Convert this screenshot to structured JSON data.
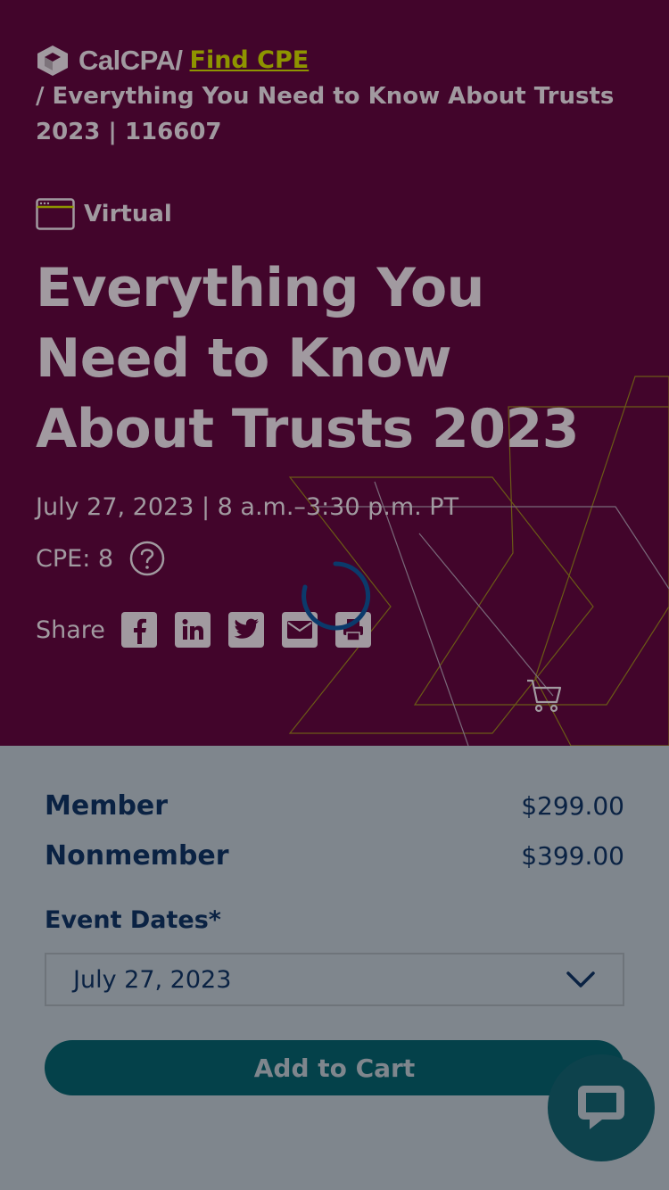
{
  "breadcrumb": {
    "logo_text": "CalCPA/",
    "link": "Find CPE",
    "rest": "/ Everything You Need to Know About Trusts 2023 | 116607"
  },
  "event": {
    "format": "Virtual",
    "title": "Everything You Need to Know About Trusts 2023",
    "date_time": "July 27, 2023 | 8 a.m.–3:30 p.m. PT",
    "cpe_label": "CPE: 8"
  },
  "share": {
    "label": "Share",
    "icons": [
      "facebook-icon",
      "linkedin-icon",
      "twitter-icon",
      "email-icon",
      "print-icon"
    ]
  },
  "pricing": {
    "member_label": "Member",
    "member_price": "$299.00",
    "nonmember_label": "Nonmember",
    "nonmember_price": "$399.00"
  },
  "dates": {
    "label": "Event Dates*",
    "selected": "July 27, 2023"
  },
  "cart": {
    "add_label": "Add to Cart"
  },
  "colors": {
    "hero_bg": "#42052b",
    "accent_link": "#8e9400",
    "primary_text": "#0a2243",
    "button_bg": "#04414a",
    "overlay_gray": "#7f868d"
  }
}
